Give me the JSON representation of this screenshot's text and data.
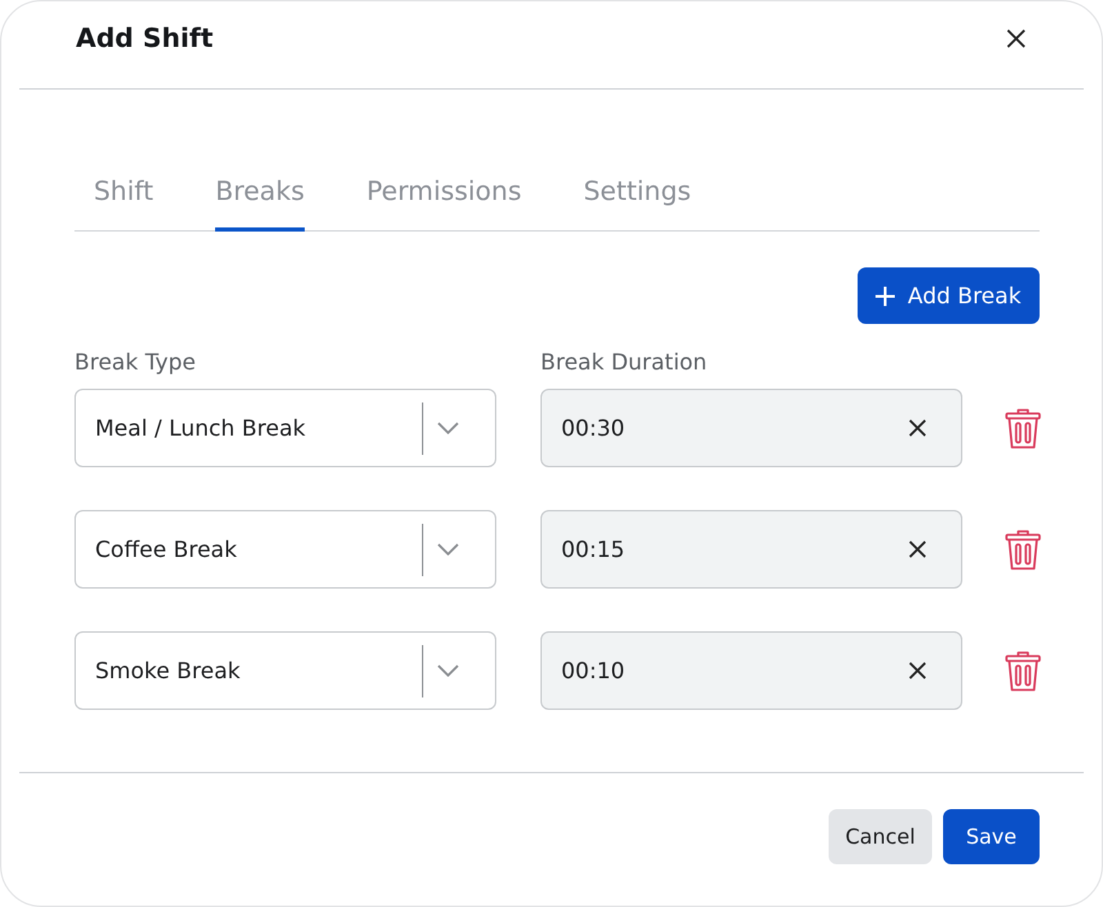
{
  "dialog": {
    "title": "Add Shift"
  },
  "tabs": [
    {
      "label": "Shift",
      "selected": false
    },
    {
      "label": "Breaks",
      "selected": true
    },
    {
      "label": "Permissions",
      "selected": false
    },
    {
      "label": "Settings",
      "selected": false
    }
  ],
  "add_button": {
    "label": "Add Break"
  },
  "columns": [
    "Break Type",
    "Break Duration"
  ],
  "breaks": [
    {
      "type": "Meal / Lunch Break",
      "duration": "00:30"
    },
    {
      "type": "Coffee Break",
      "duration": "00:15"
    },
    {
      "type": "Smoke Break",
      "duration": "00:10"
    }
  ],
  "buttons": [
    {
      "label": "Cancel",
      "kind": "secondary"
    },
    {
      "label": "Save",
      "kind": "primary"
    }
  ]
}
